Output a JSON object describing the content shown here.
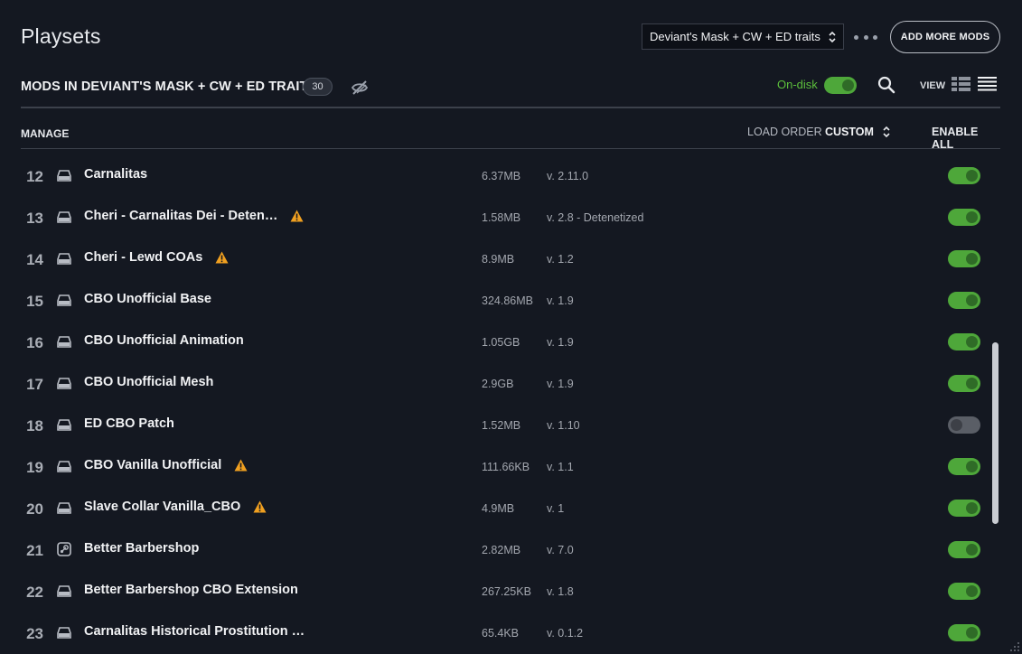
{
  "header": {
    "title": "Playsets",
    "playset_selected": "Deviant's Mask + CW + ED traits",
    "add_more_mods_label": "ADD MORE MODS"
  },
  "subheader": {
    "mods_heading": "MODS IN DEVIANT'S MASK + CW + ED TRAITS",
    "mod_count": "30",
    "ondisk_label": "On-disk",
    "ondisk_enabled": true,
    "view_label": "VIEW",
    "active_view": "list"
  },
  "manage_bar": {
    "manage_label": "MANAGE",
    "load_order_label": "LOAD ORDER",
    "load_order_value": "CUSTOM",
    "enable_all_label": "ENABLE ALL"
  },
  "colors": {
    "background": "#141821",
    "accent_green": "#4ea73a",
    "ondisk_text": "#5cbf3c",
    "warning": "#f0a020"
  },
  "mods": [
    {
      "index": "12",
      "name": "Carnalitas",
      "source": "disk-icon",
      "warning": false,
      "size": "6.37MB",
      "version": "v. 2.11.0",
      "enabled": true
    },
    {
      "index": "13",
      "name": "Cheri - Carnalitas Dei - Deten…",
      "source": "disk-icon",
      "warning": true,
      "size": "1.58MB",
      "version": "v. 2.8 - Detenetized",
      "enabled": true
    },
    {
      "index": "14",
      "name": "Cheri - Lewd COAs",
      "source": "disk-icon",
      "warning": true,
      "size": "8.9MB",
      "version": "v. 1.2",
      "enabled": true
    },
    {
      "index": "15",
      "name": "CBO Unofficial Base",
      "source": "disk-icon",
      "warning": false,
      "size": "324.86MB",
      "version": "v. 1.9",
      "enabled": true
    },
    {
      "index": "16",
      "name": "CBO Unofficial Animation",
      "source": "disk-icon",
      "warning": false,
      "size": "1.05GB",
      "version": "v. 1.9",
      "enabled": true
    },
    {
      "index": "17",
      "name": "CBO Unofficial Mesh",
      "source": "disk-icon",
      "warning": false,
      "size": "2.9GB",
      "version": "v. 1.9",
      "enabled": true
    },
    {
      "index": "18",
      "name": "ED CBO Patch",
      "source": "disk-icon",
      "warning": false,
      "size": "1.52MB",
      "version": "v. 1.10",
      "enabled": false
    },
    {
      "index": "19",
      "name": "CBO Vanilla Unofficial",
      "source": "disk-icon",
      "warning": true,
      "size": "111.66KB",
      "version": "v. 1.1",
      "enabled": true
    },
    {
      "index": "20",
      "name": "Slave Collar Vanilla_CBO",
      "source": "disk-icon",
      "warning": true,
      "size": "4.9MB",
      "version": "v. 1",
      "enabled": true
    },
    {
      "index": "21",
      "name": "Better Barbershop",
      "source": "steam-icon",
      "warning": false,
      "size": "2.82MB",
      "version": "v. 7.0",
      "enabled": true
    },
    {
      "index": "22",
      "name": "Better Barbershop CBO Extension",
      "source": "disk-icon",
      "warning": false,
      "size": "267.25KB",
      "version": "v. 1.8",
      "enabled": true
    },
    {
      "index": "23",
      "name": "Carnalitas Historical Prostitution …",
      "source": "disk-icon",
      "warning": false,
      "size": "65.4KB",
      "version": "v. 0.1.2",
      "enabled": true
    }
  ]
}
